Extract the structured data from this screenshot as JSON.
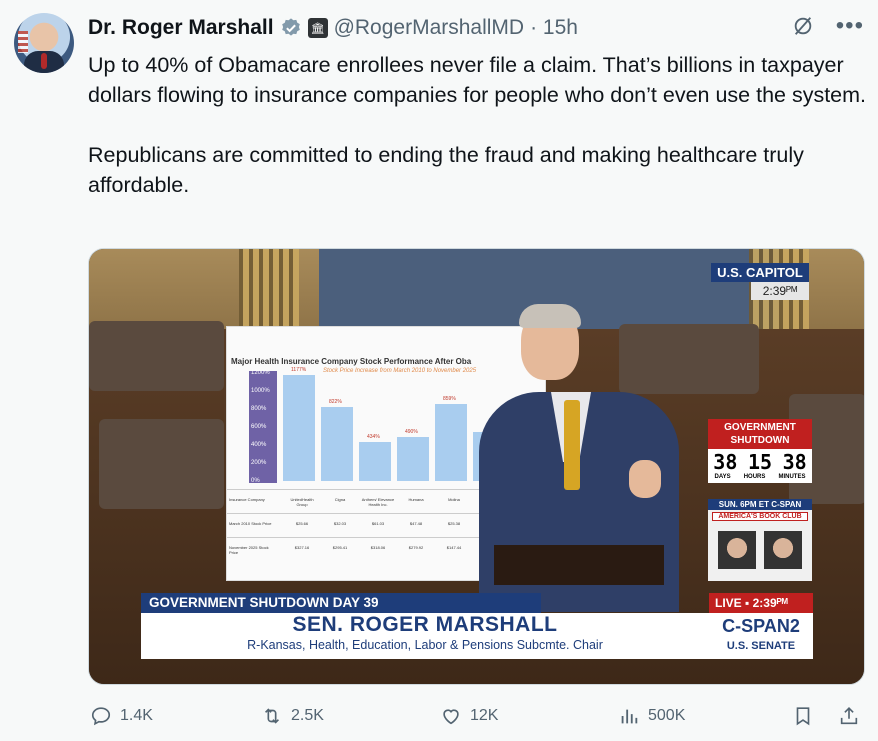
{
  "author": {
    "name": "Dr. Roger Marshall",
    "handle": "@RogerMarshallMD",
    "time": "· 15h"
  },
  "tweet": {
    "text": "Up to 40% of Obamacare enrollees never file a claim. That’s billions in taxpayer dollars flowing to insurance companies for people who don’t even use the system.\n\nRepublicans are committed to ending the fraud and making healthcare truly affordable."
  },
  "video": {
    "poster_title": "Major Health Insurance Company Stock Performance After Oba",
    "poster_subtitle": "Stock Price Increase from March 2010 to November 2025",
    "poster_yticks": [
      "1200%",
      "1000%",
      "800%",
      "600%",
      "400%",
      "200%",
      "0%"
    ],
    "poster_bar_labels": [
      "1177%",
      "822%",
      "434%",
      "490%",
      "859%"
    ],
    "poster_bar_values": [
      1177,
      822,
      434,
      490,
      859,
      550
    ],
    "poster_companies": [
      "Insurance Company",
      "UnitedHealth Group",
      "Cigna",
      "Anthem/ Elevance Health Inc.",
      "Humana",
      "Molina"
    ],
    "poster_row2_label": "March 2010 Stock Price",
    "poster_row2": [
      "$25.66",
      "$32.03",
      "$61.03",
      "$47.48",
      "$25.38"
    ],
    "poster_row3_label": "November 2025 Stock Price",
    "poster_row3": [
      "$327.16",
      "$295.41",
      "$318.06",
      "$279.92",
      "$147.44"
    ],
    "capitol_label": "U.S. CAPITOL",
    "capitol_time": "2:39ᴾᴹ",
    "shutdown_header": "GOVERNMENT SHUTDOWN",
    "shutdown_clock": [
      "38",
      "15",
      "38"
    ],
    "shutdown_units": [
      "DAYS",
      "HOURS",
      "MINUTES"
    ],
    "book_header": "SUN. 6PM ET C-SPAN",
    "book_club": "AMERICA'S BOOK CLUB",
    "chyron_top": "GOVERNMENT SHUTDOWN DAY 39",
    "chyron_name": "SEN. ROGER MARSHALL",
    "chyron_sub": "R-Kansas, Health, Education, Labor & Pensions Subcmte. Chair",
    "live_label": "LIVE ▪  2:39ᴾᴹ",
    "cspan_logo": "C-SPAN2",
    "cspan_sub": "U.S. SENATE"
  },
  "actions": {
    "replies": "1.4K",
    "reposts": "2.5K",
    "likes": "12K",
    "views": "500K"
  },
  "colors": {
    "background": "#f7f9f9",
    "muted": "#536471",
    "verified": "#829aab",
    "cspan_blue": "#1e3d7a",
    "alert_red": "#c0201f"
  }
}
